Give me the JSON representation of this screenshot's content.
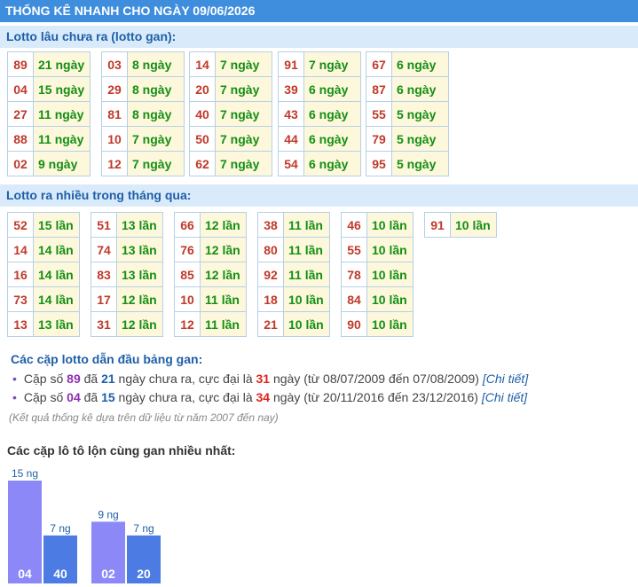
{
  "header": {
    "title": "THỐNG KÊ NHANH CHO NGÀY 09/06/2026"
  },
  "gan": {
    "title": "Lotto lâu chưa ra (lotto gan):",
    "columns": [
      [
        [
          "89",
          "21 ngày"
        ],
        [
          "04",
          "15 ngày"
        ],
        [
          "27",
          "11 ngày"
        ],
        [
          "88",
          "11 ngày"
        ],
        [
          "02",
          "9 ngày"
        ]
      ],
      [
        [
          "03",
          "8 ngày"
        ],
        [
          "29",
          "8 ngày"
        ],
        [
          "81",
          "8 ngày"
        ],
        [
          "10",
          "7 ngày"
        ],
        [
          "12",
          "7 ngày"
        ]
      ],
      [
        [
          "14",
          "7 ngày"
        ],
        [
          "20",
          "7 ngày"
        ],
        [
          "40",
          "7 ngày"
        ],
        [
          "50",
          "7 ngày"
        ],
        [
          "62",
          "7 ngày"
        ]
      ],
      [
        [
          "91",
          "7 ngày"
        ],
        [
          "39",
          "6 ngày"
        ],
        [
          "43",
          "6 ngày"
        ],
        [
          "44",
          "6 ngày"
        ],
        [
          "54",
          "6 ngày"
        ]
      ],
      [
        [
          "67",
          "6 ngày"
        ],
        [
          "87",
          "6 ngày"
        ],
        [
          "55",
          "5 ngày"
        ],
        [
          "79",
          "5 ngày"
        ],
        [
          "95",
          "5 ngày"
        ]
      ]
    ]
  },
  "frequent": {
    "title": "Lotto ra nhiều trong tháng qua:",
    "columns": [
      [
        [
          "52",
          "15 lần"
        ],
        [
          "14",
          "14 lần"
        ],
        [
          "16",
          "14 lần"
        ],
        [
          "73",
          "14 lần"
        ],
        [
          "13",
          "13 lần"
        ]
      ],
      [
        [
          "51",
          "13 lần"
        ],
        [
          "74",
          "13 lần"
        ],
        [
          "83",
          "13 lần"
        ],
        [
          "17",
          "12 lần"
        ],
        [
          "31",
          "12 lần"
        ]
      ],
      [
        [
          "66",
          "12 lần"
        ],
        [
          "76",
          "12 lần"
        ],
        [
          "85",
          "12 lần"
        ],
        [
          "10",
          "11 lần"
        ],
        [
          "12",
          "11 lần"
        ]
      ],
      [
        [
          "38",
          "11 lần"
        ],
        [
          "80",
          "11 lần"
        ],
        [
          "92",
          "11 lần"
        ],
        [
          "18",
          "10 lần"
        ],
        [
          "21",
          "10 lần"
        ]
      ],
      [
        [
          "46",
          "10 lần"
        ],
        [
          "55",
          "10 lần"
        ],
        [
          "78",
          "10 lần"
        ],
        [
          "84",
          "10 lần"
        ],
        [
          "90",
          "10 lần"
        ]
      ],
      [
        [
          "91",
          "10 lần"
        ]
      ]
    ]
  },
  "pairs": {
    "title": "Các cặp lotto dẫn đầu bảng gan:",
    "items": [
      {
        "prefix": "Cặp số",
        "number": "89",
        "mid1": "đã",
        "days": "21",
        "mid2": "ngày chưa ra, cực đại là",
        "max": "31",
        "suffix": "ngày (từ 08/07/2009 đến 07/08/2009)",
        "link": "[Chi tiết]"
      },
      {
        "prefix": "Cặp số",
        "number": "04",
        "mid1": "đã",
        "days": "15",
        "mid2": "ngày chưa ra, cực đại là",
        "max": "34",
        "suffix": "ngày (từ 20/11/2016 đến 23/12/2016)",
        "link": "[Chi tiết]"
      }
    ],
    "note": "(Kết quả thống kê dựa trên dữ liệu từ năm 2007 đến nay)"
  },
  "chart_data": {
    "type": "bar",
    "title": "Các cặp lô tô lộn cùng gan nhiều nhất:",
    "groups": [
      {
        "bars": [
          {
            "label": "04",
            "value": 15,
            "value_label": "15 ng"
          },
          {
            "label": "40",
            "value": 7,
            "value_label": "7 ng"
          }
        ]
      },
      {
        "bars": [
          {
            "label": "02",
            "value": 9,
            "value_label": "9 ng"
          },
          {
            "label": "20",
            "value": 7,
            "value_label": "7 ng"
          }
        ]
      }
    ],
    "colors": {
      "first": "#8c88f8",
      "second": "#4b7be3"
    }
  }
}
